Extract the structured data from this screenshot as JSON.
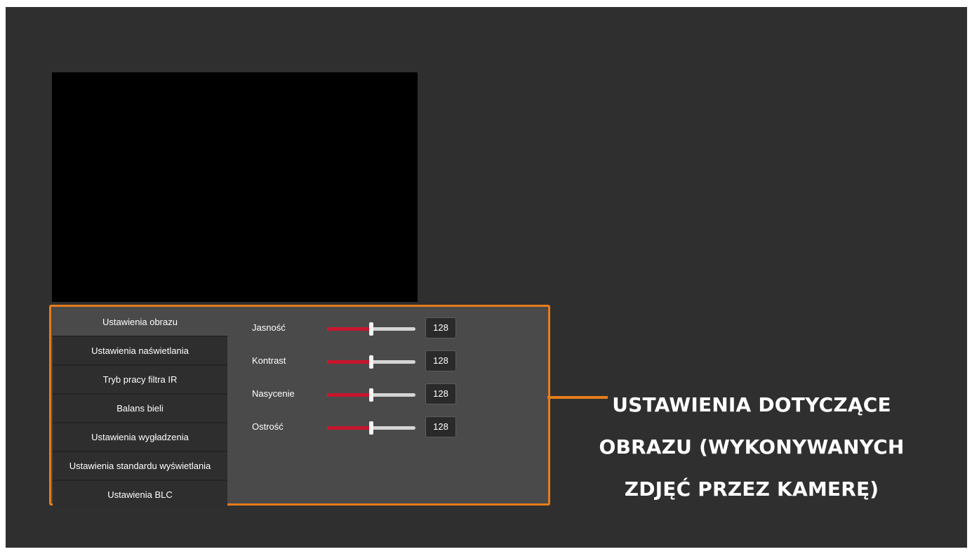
{
  "menu": {
    "items": [
      {
        "label": "Ustawienia obrazu",
        "active": true
      },
      {
        "label": "Ustawienia naświetlania",
        "active": false
      },
      {
        "label": "Tryb pracy filtra IR",
        "active": false
      },
      {
        "label": "Balans bieli",
        "active": false
      },
      {
        "label": "Ustawienia wygładzenia",
        "active": false
      },
      {
        "label": "Ustawienia standardu wyświetlania",
        "active": false
      },
      {
        "label": "Ustawienia BLC",
        "active": false
      }
    ]
  },
  "settings": {
    "range": [
      0,
      255
    ],
    "rows": [
      {
        "label": "Jasność",
        "value": 128
      },
      {
        "label": "Kontrast",
        "value": 128
      },
      {
        "label": "Nasycenie",
        "value": 128
      },
      {
        "label": "Ostrość",
        "value": 128
      }
    ]
  },
  "annotation": {
    "lines": [
      "USTAWIENIA DOTYCZĄCE",
      "OBRAZU (WYKONYWANYCH",
      "ZDJĘĆ PRZEZ KAMERĘ)"
    ]
  },
  "colors": {
    "accent_orange": "#e77c1b",
    "slider_active": "#c8152d",
    "background": "#2f2f2f"
  }
}
